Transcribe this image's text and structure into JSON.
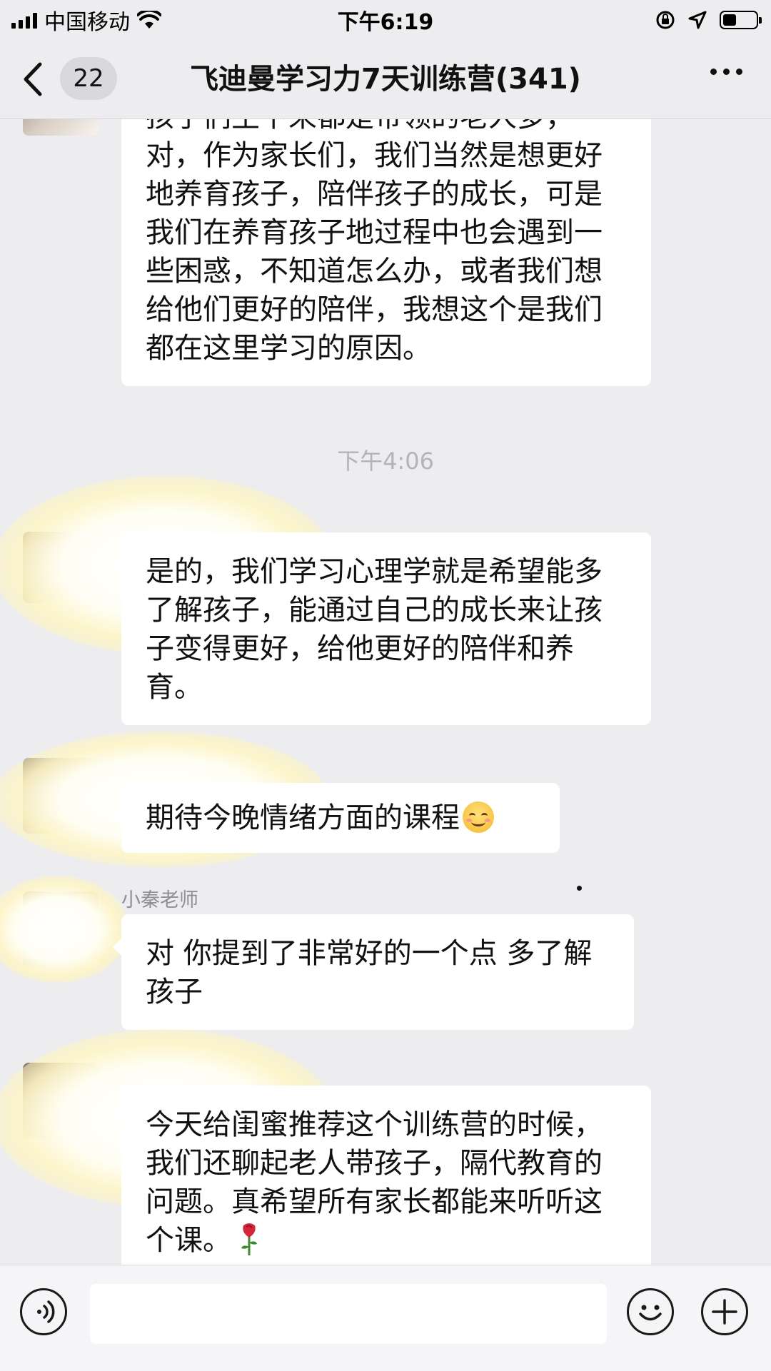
{
  "status_bar": {
    "carrier": "中国移动",
    "time": "下午6:19"
  },
  "nav": {
    "unread_count": "22",
    "title": "飞迪曼学习力7天训练营(341)"
  },
  "messages": [
    {
      "text": "孩子们生下来都是带领的老人多，对，作为家长们，我们当然是想更好地养育孩子，陪伴孩子的成长，可是我们在养育孩子地过程中也会遇到一些困惑，不知道怎么办，或者我们想给他们更好的陪伴，我想这个是我们都在这里学习的原因。"
    },
    {
      "timestamp": "下午4:06"
    },
    {
      "text": "是的，我们学习心理学就是希望能多了解孩子，能通过自己的成长来让孩子变得更好，给他更好的陪伴和养育。"
    },
    {
      "text": "期待今晚情绪方面的课程",
      "emoji": "smiling-face-emoji"
    },
    {
      "sender": "小秦老师",
      "text": "对 你提到了非常好的一个点 多了解孩子"
    },
    {
      "text": "今天给闺蜜推荐这个训练营的时候，我们还聊起老人带孩子，隔代教育的问题。真希望所有家长都能来听听这个课。",
      "emoji": "rose-emoji"
    }
  ],
  "icons": {
    "back": "chevron-left-icon",
    "more": "more-dots-icon",
    "voice": "voice-input-icon",
    "emoji": "emoji-face-icon",
    "plus": "plus-icon"
  },
  "colors": {
    "background": "#ededf0",
    "bubble": "#ffffff",
    "meta_text": "#b3b3b8"
  }
}
